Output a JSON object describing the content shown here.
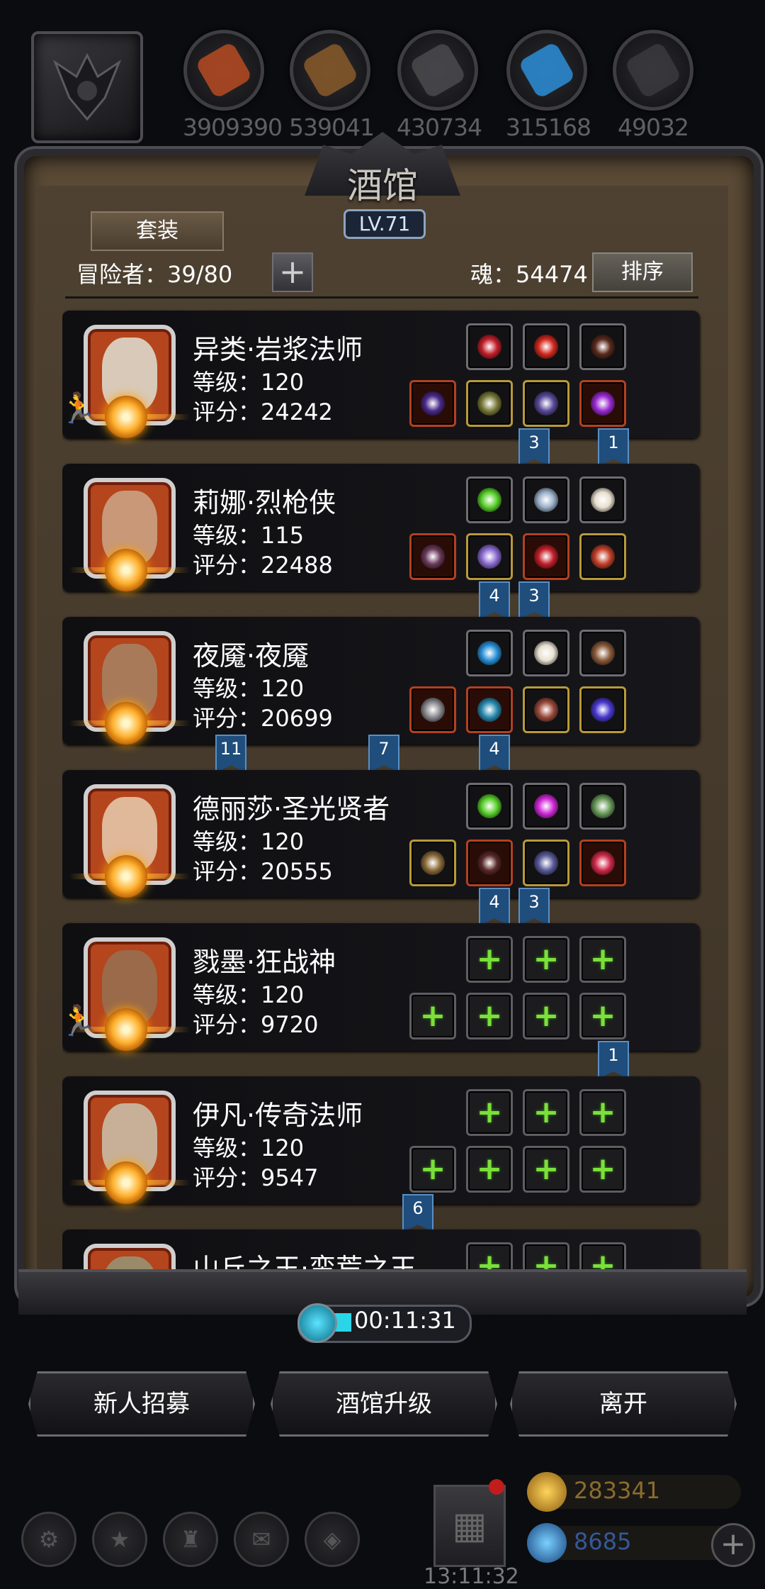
{
  "resources": [
    {
      "icon": "meat-icon",
      "value": "3909390",
      "color": "#b64a22"
    },
    {
      "icon": "wood-icon",
      "value": "539041",
      "color": "#8a5a2a"
    },
    {
      "icon": "iron-icon",
      "value": "430734",
      "color": "#4a4a4e"
    },
    {
      "icon": "crystal-icon",
      "value": "315168",
      "color": "#2b8ed8"
    },
    {
      "icon": "steel-icon",
      "value": "49032",
      "color": "#3a3a3e"
    }
  ],
  "tavern": {
    "title": "酒馆",
    "level": "LV.71",
    "set_button": "套装",
    "adventurers_label": "冒险者：39/80",
    "soul_label": "魂：54474",
    "sort_button": "排序"
  },
  "heroes": [
    {
      "name": "异类·岩浆法师",
      "level": "等级：120",
      "score": "评分：24242",
      "face": "#d9c9b8",
      "runner": true,
      "top": [
        {
          "c": "#c21f2a",
          "e": false,
          "f": ""
        },
        {
          "c": "#d22a20",
          "e": false,
          "f": ""
        },
        {
          "c": "#5a2a1e",
          "e": false,
          "f": ""
        }
      ],
      "bottom": [
        {
          "c": "#4a2a8a",
          "e": false,
          "f": "red"
        },
        {
          "c": "#7a7a3a",
          "e": false,
          "f": "gold"
        },
        {
          "c": "#5a4a9a",
          "e": false,
          "f": "gold"
        },
        {
          "c": "#9a2ad0",
          "e": false,
          "f": "red"
        }
      ],
      "tags": [
        {
          "text": "3",
          "pos": "b"
        },
        {
          "text": "1",
          "pos": "d"
        }
      ]
    },
    {
      "name": "莉娜·烈枪侠",
      "level": "等级：115",
      "score": "评分：22488",
      "face": "#c89878",
      "runner": false,
      "top": [
        {
          "c": "#58d02a",
          "e": false,
          "f": ""
        },
        {
          "c": "#9ab0c8",
          "e": false,
          "f": ""
        },
        {
          "c": "#e8e0d0",
          "e": false,
          "f": ""
        }
      ],
      "bottom": [
        {
          "c": "#6a3a5a",
          "e": false,
          "f": "red"
        },
        {
          "c": "#8a6ad0",
          "e": false,
          "f": "gold"
        },
        {
          "c": "#c2202a",
          "e": false,
          "f": "red"
        },
        {
          "c": "#c2402a",
          "e": false,
          "f": "gold"
        }
      ],
      "tags": [
        {
          "text": "4",
          "pos": "a"
        },
        {
          "text": "3",
          "pos": "b"
        }
      ]
    },
    {
      "name": "夜魇·夜魇",
      "level": "等级：120",
      "score": "评分：20699",
      "face": "#a87a5a",
      "runner": false,
      "top": [
        {
          "c": "#2a90d8",
          "e": false,
          "f": ""
        },
        {
          "c": "#e8e0d0",
          "e": false,
          "f": ""
        },
        {
          "c": "#8a5a3a",
          "e": false,
          "f": ""
        }
      ],
      "bottom": [
        {
          "c": "#8a8a90",
          "e": false,
          "f": "red"
        },
        {
          "c": "#2a8ab0",
          "e": false,
          "f": "red"
        },
        {
          "c": "#9a4a3a",
          "e": false,
          "f": "gold"
        },
        {
          "c": "#4a3ad0",
          "e": false,
          "f": "gold"
        }
      ],
      "tags": [
        {
          "text": "11",
          "pos": "x1"
        },
        {
          "text": "7",
          "pos": "x2"
        },
        {
          "text": "4",
          "pos": "a"
        }
      ]
    },
    {
      "name": "德丽莎·圣光贤者",
      "level": "等级：120",
      "score": "评分：20555",
      "face": "#e0b89a",
      "runner": false,
      "top": [
        {
          "c": "#58d02a",
          "e": false,
          "f": ""
        },
        {
          "c": "#d02ad8",
          "e": false,
          "f": ""
        },
        {
          "c": "#6a9a5a",
          "e": false,
          "f": ""
        }
      ],
      "bottom": [
        {
          "c": "#8a6a3a",
          "e": false,
          "f": "gold"
        },
        {
          "c": "#5a2a2a",
          "e": false,
          "f": "red"
        },
        {
          "c": "#5a5a9a",
          "e": false,
          "f": "gold"
        },
        {
          "c": "#d02a4a",
          "e": false,
          "f": "red"
        }
      ],
      "tags": [
        {
          "text": "4",
          "pos": "a"
        },
        {
          "text": "3",
          "pos": "b"
        }
      ]
    },
    {
      "name": "戮墨·狂战神",
      "level": "等级：120",
      "score": "评分：9720",
      "face": "#9a6a4a",
      "runner": true,
      "top": [
        {
          "c": "",
          "e": true,
          "f": ""
        },
        {
          "c": "",
          "e": true,
          "f": ""
        },
        {
          "c": "",
          "e": true,
          "f": ""
        }
      ],
      "bottom": [
        {
          "c": "",
          "e": true,
          "f": ""
        },
        {
          "c": "",
          "e": true,
          "f": ""
        },
        {
          "c": "",
          "e": true,
          "f": ""
        },
        {
          "c": "",
          "e": true,
          "f": ""
        }
      ],
      "tags": [
        {
          "text": "1",
          "pos": "d"
        }
      ]
    },
    {
      "name": "伊凡·传奇法师",
      "level": "等级：120",
      "score": "评分：9547",
      "face": "#c8b098",
      "runner": false,
      "top": [
        {
          "c": "",
          "e": true,
          "f": ""
        },
        {
          "c": "",
          "e": true,
          "f": ""
        },
        {
          "c": "",
          "e": true,
          "f": ""
        }
      ],
      "bottom": [
        {
          "c": "",
          "e": true,
          "f": ""
        },
        {
          "c": "",
          "e": true,
          "f": ""
        },
        {
          "c": "",
          "e": true,
          "f": ""
        },
        {
          "c": "",
          "e": true,
          "f": ""
        }
      ],
      "tags": [
        {
          "text": "6",
          "pos": "x3"
        }
      ]
    },
    {
      "name": "山丘之王·蛮荒之王",
      "level": "",
      "score": "",
      "face": "#9a8a6a",
      "runner": false,
      "top": [
        {
          "c": "",
          "e": true,
          "f": ""
        },
        {
          "c": "",
          "e": true,
          "f": ""
        },
        {
          "c": "",
          "e": true,
          "f": ""
        }
      ],
      "bottom": [],
      "tags": []
    }
  ],
  "timer": "00:11:31",
  "actions": {
    "recruit": "新人招募",
    "upgrade": "酒馆升级",
    "leave": "离开"
  },
  "bottom": {
    "clock": "13:11:32",
    "gold": "283341",
    "gems": "8685"
  }
}
